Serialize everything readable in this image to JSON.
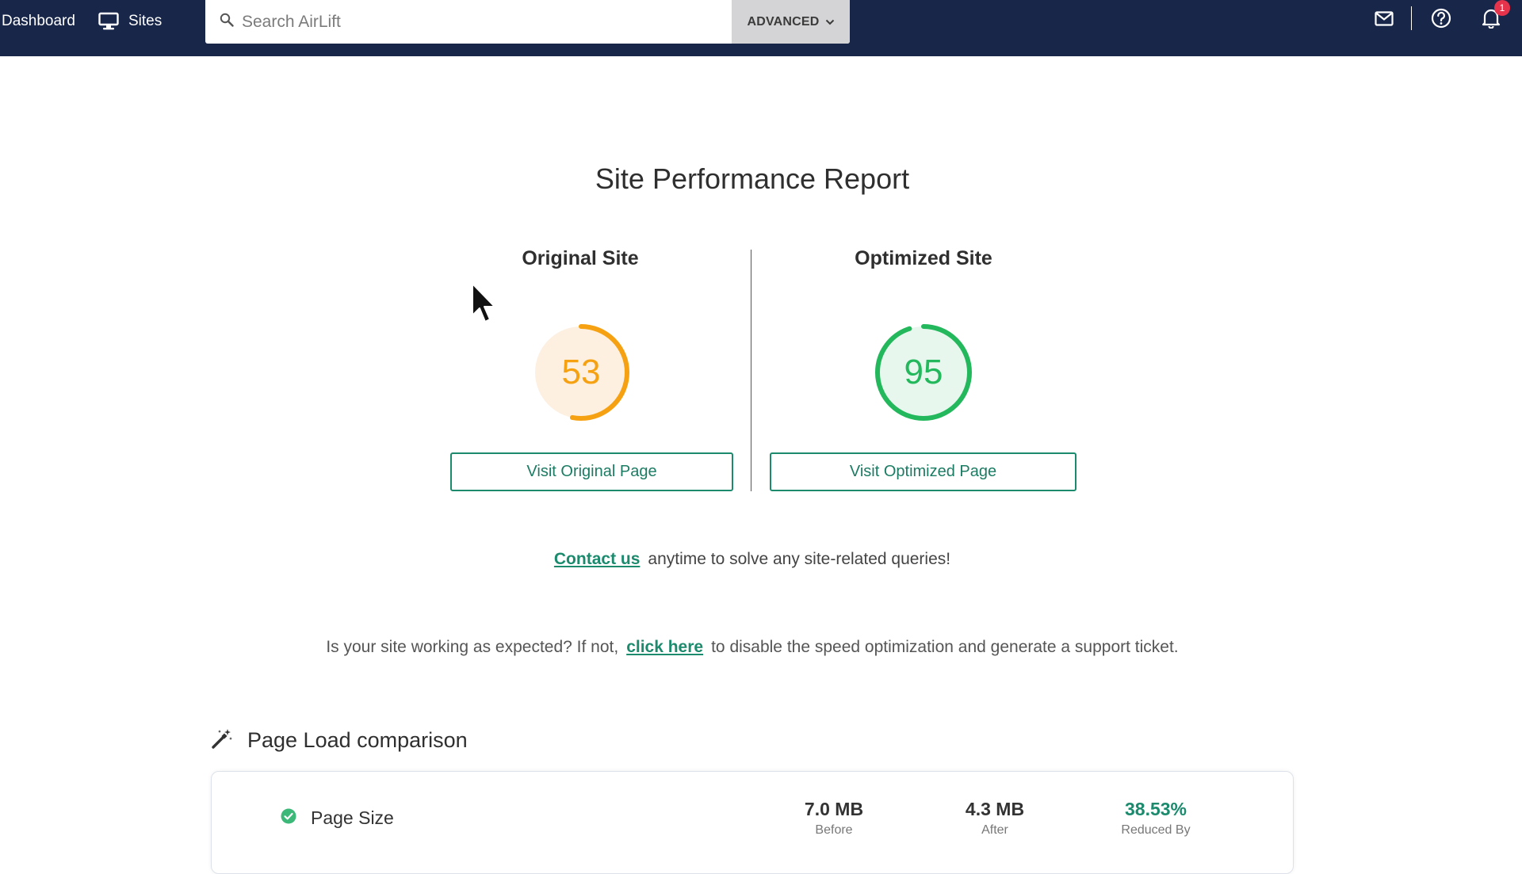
{
  "topbar": {
    "nav": {
      "dashboard_label": "Dashboard",
      "sites_label": "Sites",
      "sites_icon": "monitor-icon"
    },
    "search": {
      "placeholder": "Search AirLift",
      "value": "",
      "icon": "search-icon",
      "advanced_label": "ADVANCED"
    },
    "icons": [
      "mail-icon",
      "help-icon",
      "bell-icon"
    ],
    "notifications_count": "1",
    "colors": {
      "bar_bg": "#18264a",
      "badge": "#e5334b"
    }
  },
  "report": {
    "title": "Site Performance Report",
    "original": {
      "heading": "Original Site",
      "score": "53",
      "score_fraction": 0.53,
      "color": "#f5a111",
      "button_label": "Visit Original Page"
    },
    "optimized": {
      "heading": "Optimized Site",
      "score": "95",
      "score_fraction": 0.95,
      "color": "#23b85c",
      "button_label": "Visit Optimized Page"
    },
    "contact": {
      "link_text": "Contact us",
      "text": "anytime to solve any site-related queries!"
    },
    "support": {
      "text_before": "Is your site working as expected? If not,",
      "link_text": "click here",
      "text_after": "to disable the speed optimization and generate a support ticket."
    },
    "accent_color": "#1b8a6d"
  },
  "comparison": {
    "title": "Page Load comparison",
    "icon": "magic-wand-icon",
    "rows": [
      {
        "status_icon": "check-circle-icon",
        "name": "Page Size",
        "before": "7.0 MB",
        "before_label": "Before",
        "after": "4.3 MB",
        "after_label": "After",
        "reduced": "38.53%",
        "reduced_label": "Reduced By"
      }
    ]
  }
}
